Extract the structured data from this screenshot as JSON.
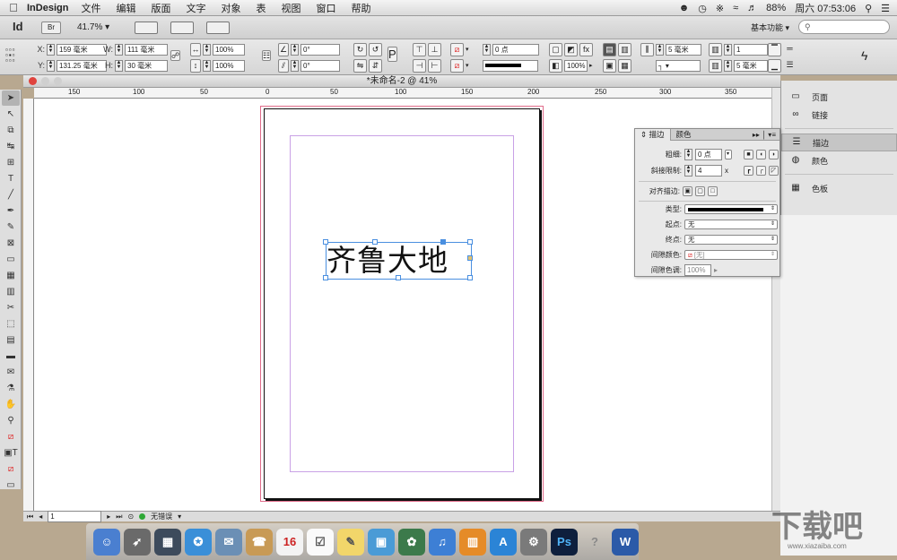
{
  "menubar": {
    "app": "InDesign",
    "items": [
      "文件",
      "编辑",
      "版面",
      "文字",
      "对象",
      "表",
      "视图",
      "窗口",
      "帮助"
    ],
    "battery": "88%",
    "clock": "周六 07:53:06"
  },
  "appbar": {
    "logo": "Id",
    "bridge": "Br",
    "zoom": "41.7%",
    "workspace": "基本功能"
  },
  "control": {
    "x_label": "X:",
    "x_value": "159 毫米",
    "y_label": "Y:",
    "y_value": "131.25 毫米",
    "w_label": "W:",
    "w_value": "111 毫米",
    "h_label": "H:",
    "h_value": "30 毫米",
    "scale_x": "100%",
    "scale_y": "100%",
    "rotate": "0°",
    "shear": "0°",
    "stroke_weight": "0 点",
    "opacity": "100%",
    "cols": "5 毫米",
    "gutter_top": "1",
    "gutter_bottom": "5 毫米",
    "text_p": "P"
  },
  "document": {
    "title": "*未命名-2 @ 41%",
    "ruler_ticks": [
      "150",
      "100",
      "50",
      "0",
      "50",
      "100",
      "150",
      "200",
      "250",
      "300",
      "350"
    ],
    "text": "齐鲁大地"
  },
  "status": {
    "page": "1",
    "errors": "无错误"
  },
  "dock_panels": [
    {
      "icon": "page-icon",
      "label": "页面"
    },
    {
      "icon": "link-icon",
      "label": "链接"
    },
    {
      "icon": "stroke-icon",
      "label": "描边"
    },
    {
      "icon": "color-icon",
      "label": "颜色"
    },
    {
      "icon": "swatches-icon",
      "label": "色板"
    }
  ],
  "stroke_panel": {
    "tab_stroke": "描边",
    "tab_color": "颜色",
    "weight_label": "粗细:",
    "weight_value": "0 点",
    "miter_label": "斜接限制:",
    "miter_value": "4",
    "miter_unit": "x",
    "align_label": "对齐描边:",
    "type_label": "类型:",
    "start_label": "起点:",
    "start_value": "无",
    "end_label": "终点:",
    "end_value": "无",
    "gap_color_label": "间隙颜色:",
    "gap_color_value": "[无]",
    "gap_tint_label": "间隙色调:",
    "gap_tint_value": "100%"
  },
  "watermark": {
    "text": "下载吧",
    "url": "www.xiazaiba.com"
  }
}
